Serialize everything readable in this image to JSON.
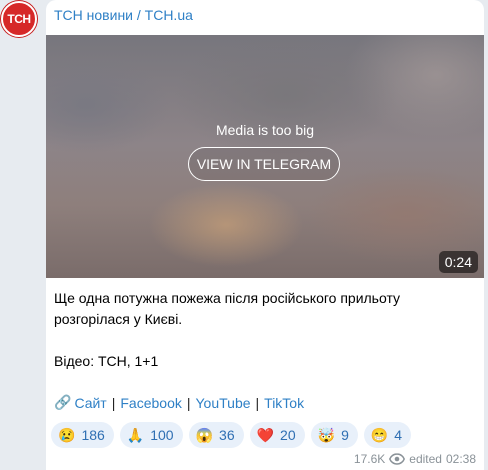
{
  "channel": {
    "avatar_text": "ТСН",
    "name": "ТСН новини / TCH.ua"
  },
  "media": {
    "notice": "Media is too big",
    "button_label": "VIEW IN TELEGRAM",
    "duration": "0:24"
  },
  "message": {
    "line1": "Ще одна потужна пожежа після російського прильоту",
    "line2": "розгорілася у Києві.",
    "video_credit": "Відео: ТСН, 1+1"
  },
  "links": {
    "link_icon": "🔗",
    "site": "Сайт",
    "facebook": "Facebook",
    "youtube": "YouTube",
    "tiktok": "TikTok",
    "separator": "|"
  },
  "reactions": [
    {
      "emoji": "😢",
      "icon": "crying-face-icon",
      "count": "186"
    },
    {
      "emoji": "🙏",
      "icon": "praying-hands-icon",
      "count": "100"
    },
    {
      "emoji": "😱",
      "icon": "screaming-face-icon",
      "count": "36"
    },
    {
      "emoji": "❤️",
      "icon": "red-heart-icon",
      "count": "20"
    },
    {
      "emoji": "🤯",
      "icon": "exploding-head-icon",
      "count": "9"
    },
    {
      "emoji": "😁",
      "icon": "grinning-face-icon",
      "count": "4"
    }
  ],
  "footer": {
    "views": "17.6K",
    "edited": "edited",
    "time": "02:38"
  },
  "colors": {
    "avatar_red": "#d62828",
    "link_blue": "#2f80c6",
    "reaction_bg": "#e8f0fa",
    "page_bg": "#e7ebf0"
  }
}
